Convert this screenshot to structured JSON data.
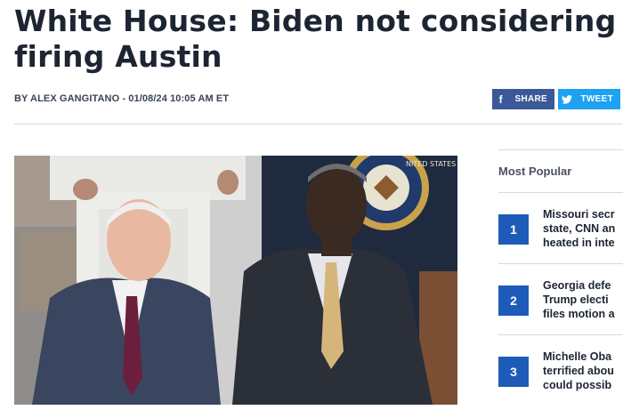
{
  "article": {
    "headline_line1": "White House: Biden not considering",
    "headline_line2": "firing Austin",
    "byline": "BY ALEX GANGITANO - 01/08/24 10:05 AM ET"
  },
  "share": {
    "facebook_icon": "f",
    "facebook_label": "SHARE",
    "twitter_icon": "twitter-bird-icon",
    "twitter_label": "TWEET",
    "facebook_color": "#3b5998",
    "twitter_color": "#1da1f2"
  },
  "photo": {
    "seal_text": "NITED STATES"
  },
  "sidebar": {
    "title": "Most Popular",
    "accent": "#1e5bb8",
    "items": [
      {
        "num": "1",
        "text": "Missouri secr\nstate, CNN an\nheated in inte"
      },
      {
        "num": "2",
        "text": "Georgia defe\nTrump electi\nfiles motion a"
      },
      {
        "num": "3",
        "text": "Michelle Oba\nterrified abou\ncould possib"
      }
    ]
  }
}
